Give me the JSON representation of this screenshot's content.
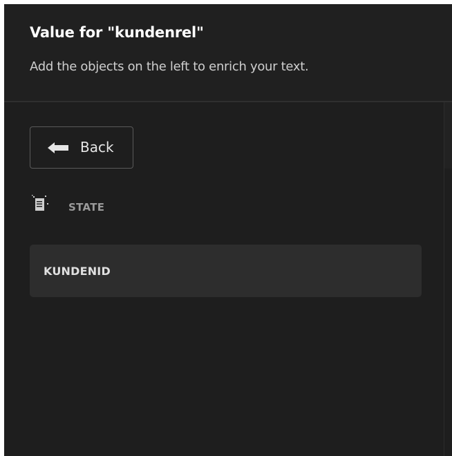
{
  "header": {
    "title": "Value for \"kundenrel\"",
    "subtitle": "Add the objects on the left to enrich your text."
  },
  "navigation": {
    "back_label": "Back",
    "back_icon": "arrow-left-icon"
  },
  "section": {
    "label": "STATE",
    "icon": "state-document-icon"
  },
  "items": [
    {
      "label": "KUNDENID"
    }
  ],
  "colors": {
    "background": "#1e1e1e",
    "item_background": "#2d2d2d",
    "border": "#5a5a5a",
    "muted_text": "#9a9a9a"
  }
}
